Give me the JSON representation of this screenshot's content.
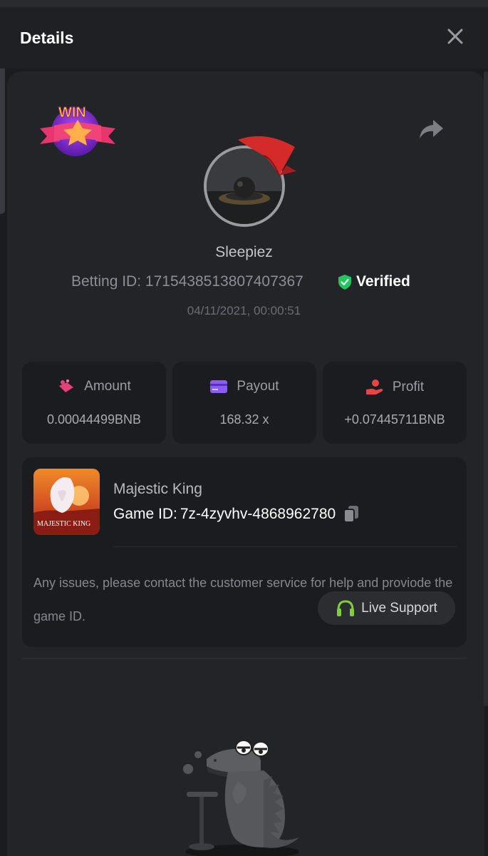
{
  "header": {
    "title": "Details"
  },
  "player": {
    "name": "Sleepiez",
    "betting_id_label": "Betting ID:",
    "betting_id": "1715438513807407367",
    "verified_label": "Verified",
    "datetime": "04/11/2021, 00:00:51",
    "win_badge_text": "WIN"
  },
  "stats": [
    {
      "label": "Amount",
      "value": "0.00044499BNB",
      "icon": "coins-icon",
      "color": "#e8417a"
    },
    {
      "label": "Payout",
      "value": "168.32 x",
      "icon": "card-icon",
      "color": "#8b5cf6"
    },
    {
      "label": "Profit",
      "value": "+0.07445711BNB",
      "icon": "profit-hand-icon",
      "color": "#e84545"
    }
  ],
  "game": {
    "name": "Majestic King",
    "id_label": "Game ID:",
    "id_value": "7z-4zyvhv-4868962780",
    "thumb_text": "MAJESTIC KING",
    "issues_text": "Any issues, please contact the customer service for help and proviode the game ID.",
    "support_label": "Live Support"
  },
  "colors": {
    "background": "#1b1c1f",
    "card": "#232428",
    "verified": "#22c55e",
    "support_icon": "#7fcf3a"
  }
}
